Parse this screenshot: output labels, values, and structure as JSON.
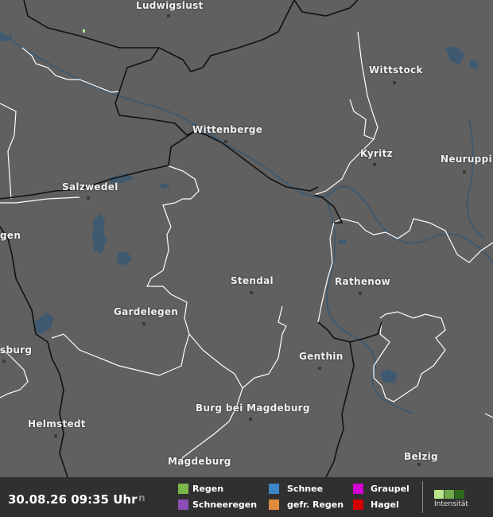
{
  "map": {
    "cities": [
      {
        "name": "Ludwigslust"
      },
      {
        "name": "Wittstock"
      },
      {
        "name": "Wittenberge"
      },
      {
        "name": "Kyritz"
      },
      {
        "name": "Neuruppin"
      },
      {
        "name": "Salzwedel"
      },
      {
        "name": "gen"
      },
      {
        "name": "Stendal"
      },
      {
        "name": "Rathenow"
      },
      {
        "name": "Gardelegen"
      },
      {
        "name": "sburg"
      },
      {
        "name": "Genthin"
      },
      {
        "name": "Helmstedt"
      },
      {
        "name": "Burg bei Magdeburg"
      },
      {
        "name": "Belzig"
      },
      {
        "name": "Magdeburg"
      },
      {
        "name": "n"
      }
    ],
    "colors": {
      "land": "#606060",
      "water": "#3f5a70",
      "state_border": "#111111",
      "district_border": "#ffffff"
    }
  },
  "legend": {
    "timestamp": "30.08.26 09:35 Uhr",
    "items": [
      {
        "label": "Regen",
        "color": "#7ab648"
      },
      {
        "label": "Schneeregen",
        "color": "#8a4fb5"
      },
      {
        "label": "Schnee",
        "color": "#3d86c6"
      },
      {
        "label": "gefr. Regen",
        "color": "#e08a3c"
      },
      {
        "label": "Graupel",
        "color": "#d400d4"
      },
      {
        "label": "Hagel",
        "color": "#d40000"
      }
    ],
    "intensity_label": "Intensität",
    "intensity_colors": [
      "#b9e68a",
      "#6fa94a",
      "#2f6a1e"
    ]
  }
}
